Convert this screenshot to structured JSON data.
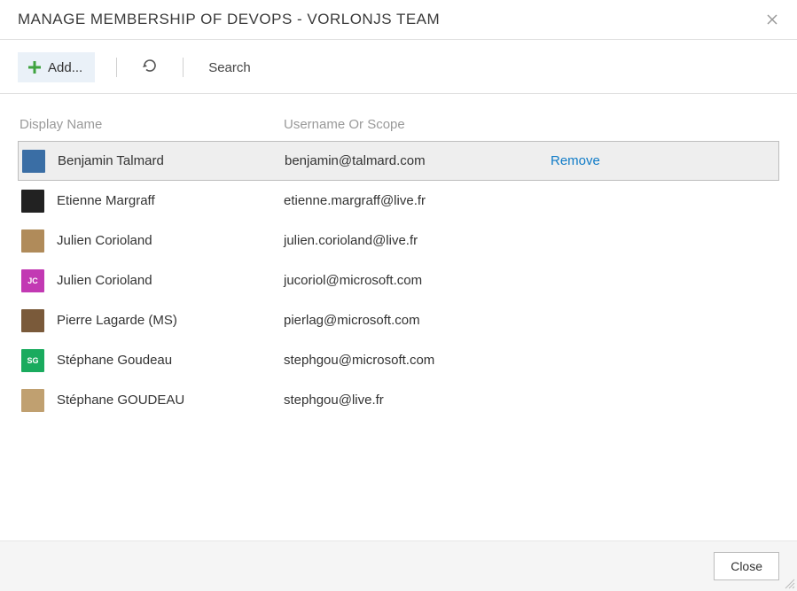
{
  "header": {
    "title": "MANAGE MEMBERSHIP OF DEVOPS - VORLONJS TEAM"
  },
  "toolbar": {
    "add_label": "Add...",
    "search_label": "Search"
  },
  "table": {
    "columns": {
      "display_name": "Display Name",
      "username": "Username Or Scope"
    },
    "remove_label": "Remove",
    "members": [
      {
        "name": "Benjamin Talmard",
        "username": "benjamin@talmard.com",
        "avatar_class": "avatar-bt",
        "initials": "",
        "selected": true
      },
      {
        "name": "Etienne Margraff",
        "username": "etienne.margraff@live.fr",
        "avatar_class": "avatar-em",
        "initials": "",
        "selected": false
      },
      {
        "name": "Julien Corioland",
        "username": "julien.corioland@live.fr",
        "avatar_class": "avatar-jc2",
        "initials": "",
        "selected": false
      },
      {
        "name": "Julien Corioland",
        "username": "jucoriol@microsoft.com",
        "avatar_class": "avatar-jc",
        "initials": "JC",
        "selected": false
      },
      {
        "name": "Pierre Lagarde (MS)",
        "username": "pierlag@microsoft.com",
        "avatar_class": "avatar-pl",
        "initials": "",
        "selected": false
      },
      {
        "name": "Stéphane Goudeau",
        "username": "stephgou@microsoft.com",
        "avatar_class": "avatar-sg",
        "initials": "SG",
        "selected": false
      },
      {
        "name": "Stéphane GOUDEAU",
        "username": "stephgou@live.fr",
        "avatar_class": "avatar-sg2",
        "initials": "",
        "selected": false
      }
    ]
  },
  "footer": {
    "close_label": "Close"
  }
}
